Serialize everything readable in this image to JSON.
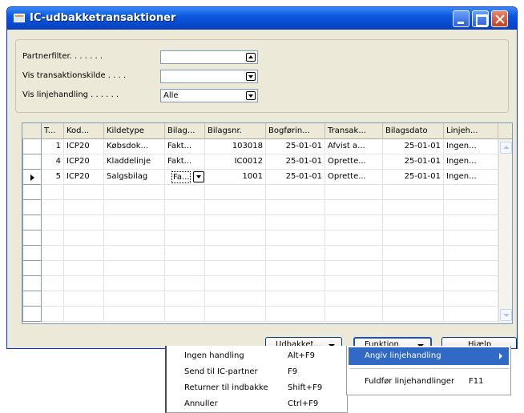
{
  "window": {
    "title": "IC-udbakketransaktioner"
  },
  "filters": [
    {
      "label": "Partnerfilter. . . . . . .",
      "value": "",
      "button": "up"
    },
    {
      "label": "Vis transaktionskilde . . . .",
      "value": "",
      "button": "down"
    },
    {
      "label": "Vis linjehandling . . . . . .",
      "value": "Alle",
      "button": "down"
    }
  ],
  "grid": {
    "columns": [
      "T...",
      "Kod...",
      "Kildetype",
      "Bilag...",
      "Bilagsnr.",
      "Bogførin...",
      "Transak...",
      "Bilagsdato",
      "Linjeh..."
    ],
    "rows": [
      [
        "1",
        "ICP20",
        "Købsdok...",
        "Fakt...",
        "103018",
        "25-01-01",
        "Afvist a...",
        "25-01-01",
        "Ingen..."
      ],
      [
        "4",
        "ICP20",
        "Kladdelinje",
        "Fakt...",
        "IC0012",
        "25-01-01",
        "Oprette...",
        "25-01-01",
        "Ingen..."
      ],
      [
        "5",
        "ICP20",
        "Salgsbilag",
        "Fa...",
        "1001",
        "25-01-01",
        "Oprette...",
        "25-01-01",
        "Ingen..."
      ]
    ],
    "active_row": 2
  },
  "buttons": {
    "udbakket": "Udbakket...",
    "funktion": "Funktion",
    "hjaelp": "Hjælp"
  },
  "menu_udbakket": [
    {
      "label": "Ingen handling",
      "shortcut": "Alt+F9"
    },
    {
      "label": "Send til IC-partner",
      "shortcut": "F9"
    },
    {
      "label": "Returner til indbakke",
      "shortcut": "Shift+F9"
    },
    {
      "label": "Annuller",
      "shortcut": "Ctrl+F9"
    }
  ],
  "menu_funktion": {
    "angiv": "Angiv linjehandling",
    "fuldfor": "Fuldfør linjehandlinger",
    "fuldfor_shortcut": "F11"
  },
  "colors": {
    "titlebar": "#0a58df",
    "menu_highlight": "#316ac5",
    "window_bg": "#ece9d8"
  }
}
